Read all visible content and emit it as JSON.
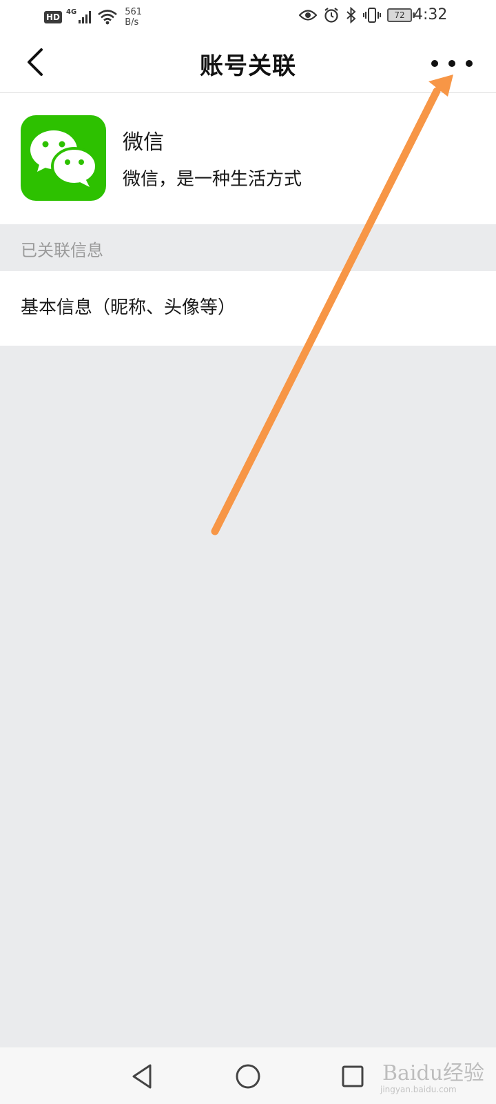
{
  "status_bar": {
    "hd_badge": "HD",
    "network_type": "4G",
    "speed_value": "561",
    "speed_unit": "B/s",
    "battery_level": "72",
    "time": "4:32"
  },
  "header": {
    "title": "账号关联",
    "back_icon": "chevron-left-icon",
    "more_icon": "ellipsis-icon"
  },
  "app": {
    "name": "微信",
    "description": "微信，是一种生活方式",
    "icon": "wechat-logo-icon",
    "brand_color": "#2DC100"
  },
  "linked_section": {
    "header": "已关联信息",
    "items": [
      {
        "label": "基本信息（昵称、头像等）"
      }
    ]
  },
  "annotation": {
    "arrow_color": "#F79646"
  },
  "system_nav": {
    "back_icon": "triangle-back-icon",
    "home_icon": "circle-home-icon",
    "recent_icon": "square-recents-icon"
  },
  "watermark": {
    "text": "Baidu经验",
    "sub": "jingyan.baidu.com"
  }
}
